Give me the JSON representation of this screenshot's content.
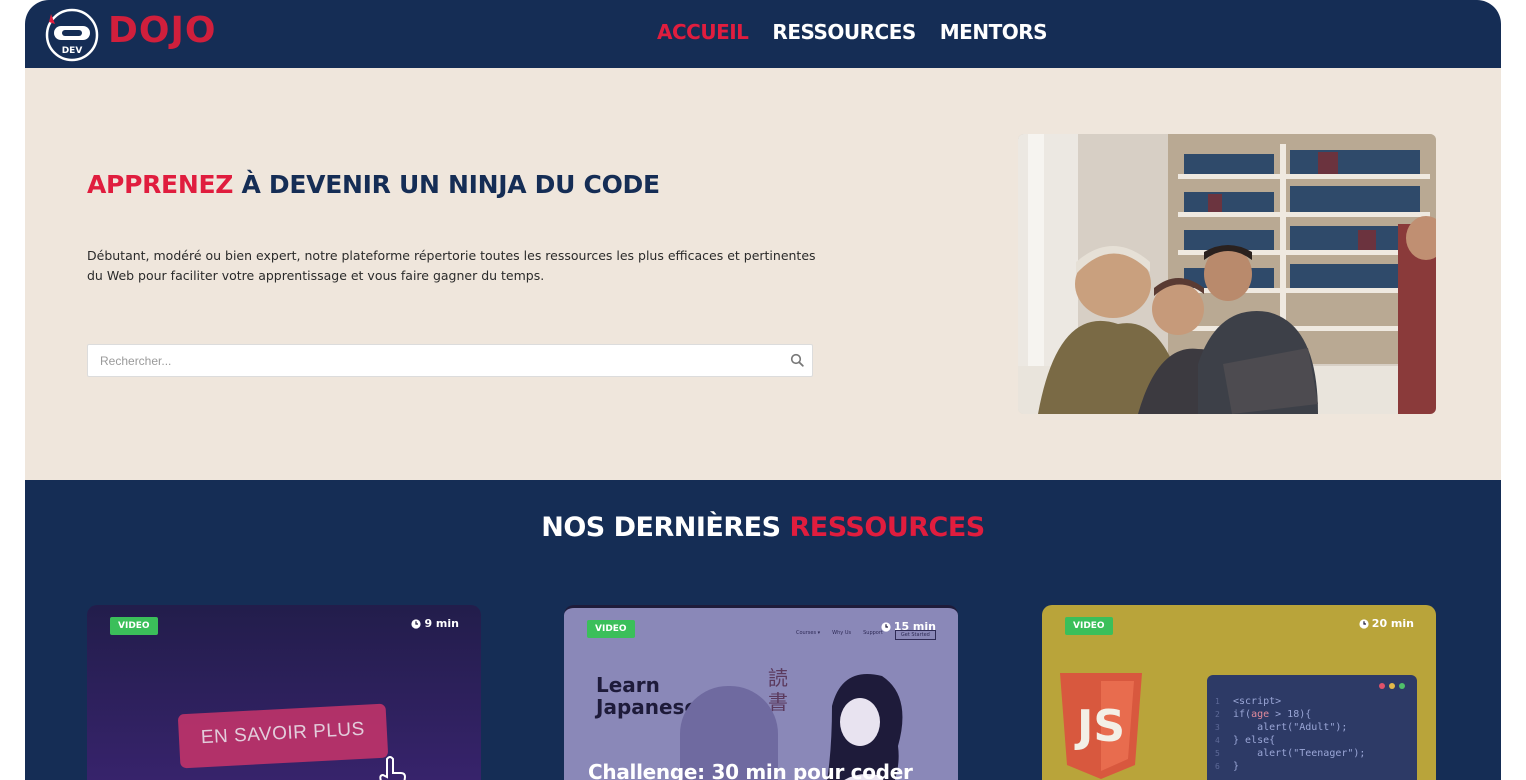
{
  "header": {
    "brand": "DOJO",
    "logo_text": "DEV",
    "nav": [
      {
        "label": "ACCUEIL",
        "active": true
      },
      {
        "label": "RESSOURCES",
        "active": false
      },
      {
        "label": "MENTORS",
        "active": false
      }
    ]
  },
  "hero": {
    "title_accent": "APPRENEZ",
    "title_rest": " À DEVENIR UN NINJA DU CODE",
    "description": "Débutant, modéré ou bien expert, notre plateforme répertorie toutes les ressources les plus efficaces et pertinentes du Web pour faciliter votre apprentissage et vous faire gagner du temps.",
    "search_placeholder": "Rechercher..."
  },
  "resources": {
    "title_main": "NOS DERNIÈRES ",
    "title_accent": "RESSOURCES",
    "cards": [
      {
        "badge": "VIDEO",
        "duration": "9 min",
        "thumb_text": "EN SAVOIR PLUS"
      },
      {
        "badge": "VIDEO",
        "duration": "15 min",
        "thumb_heading": "Learn Japanese",
        "title": "Challenge: 30 min pour coder",
        "kanji": "読書"
      },
      {
        "badge": "VIDEO",
        "duration": "20 min",
        "logo_text": "JS"
      }
    ]
  },
  "colors": {
    "navy": "#152d55",
    "red": "#e01d3e",
    "cream": "#efe6dc",
    "badge_green": "#3bbf5a"
  }
}
